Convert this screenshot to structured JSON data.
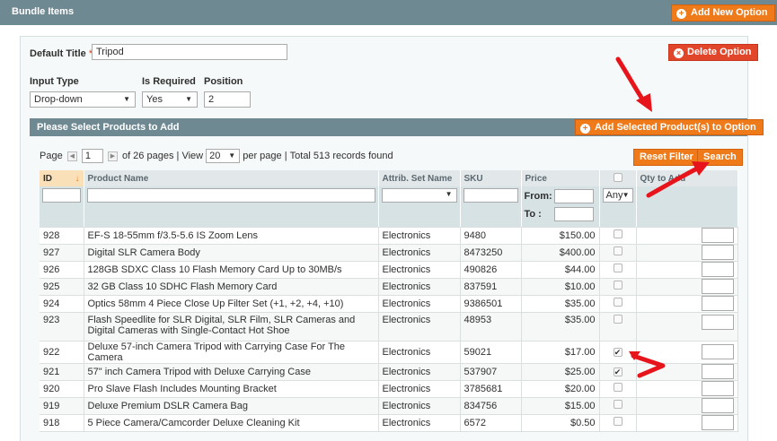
{
  "header": {
    "title": "Bundle Items",
    "add_option": "Add New Option"
  },
  "option": {
    "default_title_label": "Default Title",
    "required_star": "*",
    "default_title_value": "Tripod",
    "delete_label": "Delete Option",
    "input_type_label": "Input Type",
    "input_type_value": "Drop-down",
    "is_required_label": "Is Required",
    "is_required_value": "Yes",
    "position_label": "Position",
    "position_value": "2"
  },
  "grid": {
    "title": "Please Select Products to Add",
    "add_selected": "Add Selected Product(s) to Option",
    "reset_filter": "Reset Filter",
    "search": "Search",
    "pager": {
      "page_label": "Page",
      "page_value": "1",
      "of_pages": "of 26 pages",
      "sep1": "|",
      "view_label": "View",
      "view_value": "20",
      "per_page": "per page",
      "sep2": "|",
      "total": "Total 513 records found"
    },
    "columns": {
      "id": "ID",
      "sort_icon": "↓",
      "name": "Product Name",
      "attrib": "Attrib. Set Name",
      "sku": "SKU",
      "price": "Price",
      "qty": "Qty to Add"
    },
    "filters": {
      "from": "From:",
      "to": "To :",
      "any": "Any"
    },
    "rows": [
      {
        "id": "928",
        "name": "EF-S 18-55mm f/3.5-5.6 IS Zoom Lens",
        "attrib": "Electronics",
        "sku": "9480",
        "price": "$150.00",
        "checked": ""
      },
      {
        "id": "927",
        "name": "Digital SLR Camera Body",
        "attrib": "Electronics",
        "sku": "8473250",
        "price": "$400.00",
        "checked": ""
      },
      {
        "id": "926",
        "name": "128GB SDXC Class 10 Flash Memory Card Up to 30MB/s",
        "attrib": "Electronics",
        "sku": "490826",
        "price": "$44.00",
        "checked": ""
      },
      {
        "id": "925",
        "name": "32 GB Class 10 SDHC Flash Memory Card",
        "attrib": "Electronics",
        "sku": "837591",
        "price": "$10.00",
        "checked": ""
      },
      {
        "id": "924",
        "name": "Optics 58mm 4 Piece Close Up Filter Set (+1, +2, +4, +10)",
        "attrib": "Electronics",
        "sku": "9386501",
        "price": "$35.00",
        "checked": ""
      },
      {
        "id": "923",
        "name": "Flash Speedlite for SLR Digital, SLR Film, SLR Cameras and Digital Cameras with Single-Contact Hot Shoe",
        "attrib": "Electronics",
        "sku": "48953",
        "price": "$35.00",
        "checked": ""
      },
      {
        "id": "922",
        "name": "Deluxe 57-inch Camera Tripod with Carrying Case For The Camera",
        "attrib": "Electronics",
        "sku": "59021",
        "price": "$17.00",
        "checked": "✔"
      },
      {
        "id": "921",
        "name": "57\" inch Camera Tripod with Deluxe Carrying Case",
        "attrib": "Electronics",
        "sku": "537907",
        "price": "$25.00",
        "checked": "✔"
      },
      {
        "id": "920",
        "name": "Pro Slave Flash Includes Mounting Bracket",
        "attrib": "Electronics",
        "sku": "3785681",
        "price": "$20.00",
        "checked": ""
      },
      {
        "id": "919",
        "name": "Deluxe Premium DSLR Camera Bag",
        "attrib": "Electronics",
        "sku": "834756",
        "price": "$15.00",
        "checked": ""
      },
      {
        "id": "918",
        "name": "5 Piece Camera/Camcorder Deluxe Cleaning Kit",
        "attrib": "Electronics",
        "sku": "6572",
        "price": "$0.50",
        "checked": ""
      }
    ]
  },
  "colors": {
    "header": "#6f8992",
    "orange": "#ef7a1a",
    "red": "#e2462a",
    "arrow": "#e8141c"
  },
  "icons": {
    "add": "⊕",
    "delete": "⊗",
    "select_arrow": "▼",
    "prev": "◀",
    "next": "▶"
  }
}
